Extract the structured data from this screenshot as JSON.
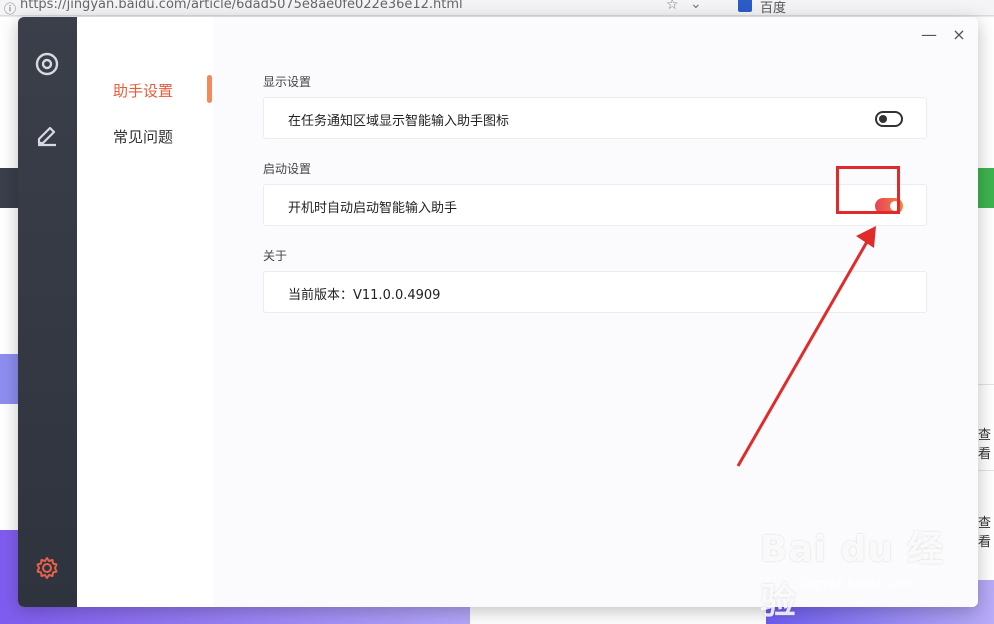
{
  "browser": {
    "url": "https://jingyan.baidu.com/article/6dad5075e8ae0fe022e36e12.html",
    "tab_label": "百度"
  },
  "background": {
    "right_text_1": "查看",
    "right_text_2": "查看",
    "watermark": "Bai du 经验",
    "watermark_sub": "jingyan.baidu.com"
  },
  "nav": {
    "items": [
      {
        "label": "助手设置",
        "active": true
      },
      {
        "label": "常见问题",
        "active": false
      }
    ]
  },
  "window": {
    "minimize": "—",
    "close": "×"
  },
  "sections": [
    {
      "label": "显示设置",
      "row_text": "在任务通知区域显示智能输入助手图标",
      "toggle": "off"
    },
    {
      "label": "启动设置",
      "row_text": "开机时自动启动智能输入助手",
      "toggle": "on"
    },
    {
      "label": "关于",
      "row_text": "当前版本：V11.0.0.4909"
    }
  ],
  "icons": {
    "rail_top": "target-icon",
    "rail_middle": "edit-icon",
    "rail_bottom": "gear-icon"
  },
  "colors": {
    "accent": "#e85c3b",
    "toggle_on_start": "#e8415a",
    "toggle_on_end": "#f3893a",
    "annotation": "#e02b2b"
  }
}
